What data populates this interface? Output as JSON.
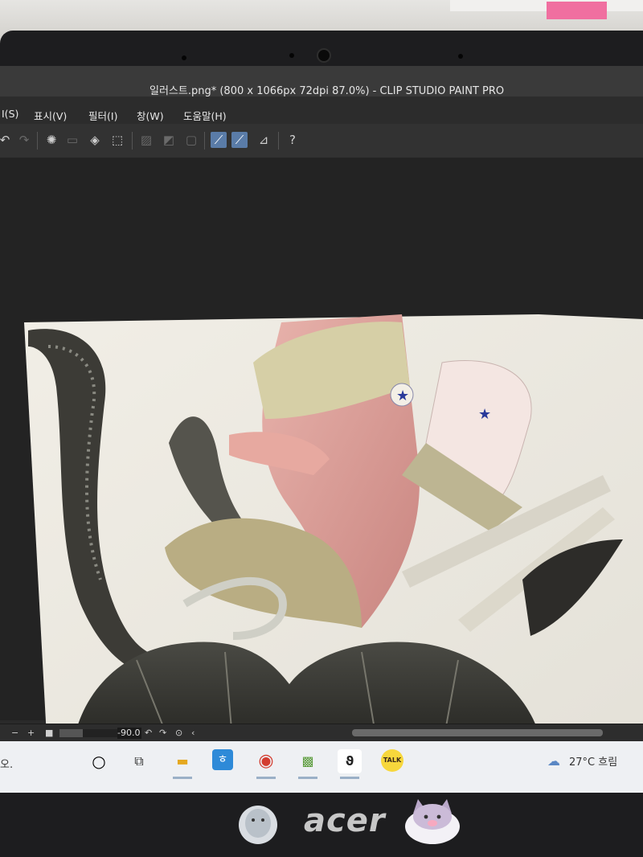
{
  "window": {
    "title": "일러스트.png* (800 x 1066px 72dpi 87.0%)  - CLIP STUDIO PAINT PRO"
  },
  "menu": {
    "items": [
      "I(S)",
      "표시(V)",
      "필터(I)",
      "창(W)",
      "도움말(H)"
    ]
  },
  "status": {
    "angle": "-90.0"
  },
  "taskbar": {
    "search_text": "오.",
    "weather": "27°C 흐림",
    "apps": [
      "task-view",
      "file-explorer",
      "hangul",
      "chrome",
      "photo-app",
      "clip-studio",
      "kakaotalk"
    ],
    "kakao_label": "TALK"
  },
  "brand": {
    "logo": "acer"
  },
  "colors": {
    "accent": "#5a7ca8",
    "taskbar": "#eef0f3",
    "bezel": "#1d1d1f"
  }
}
